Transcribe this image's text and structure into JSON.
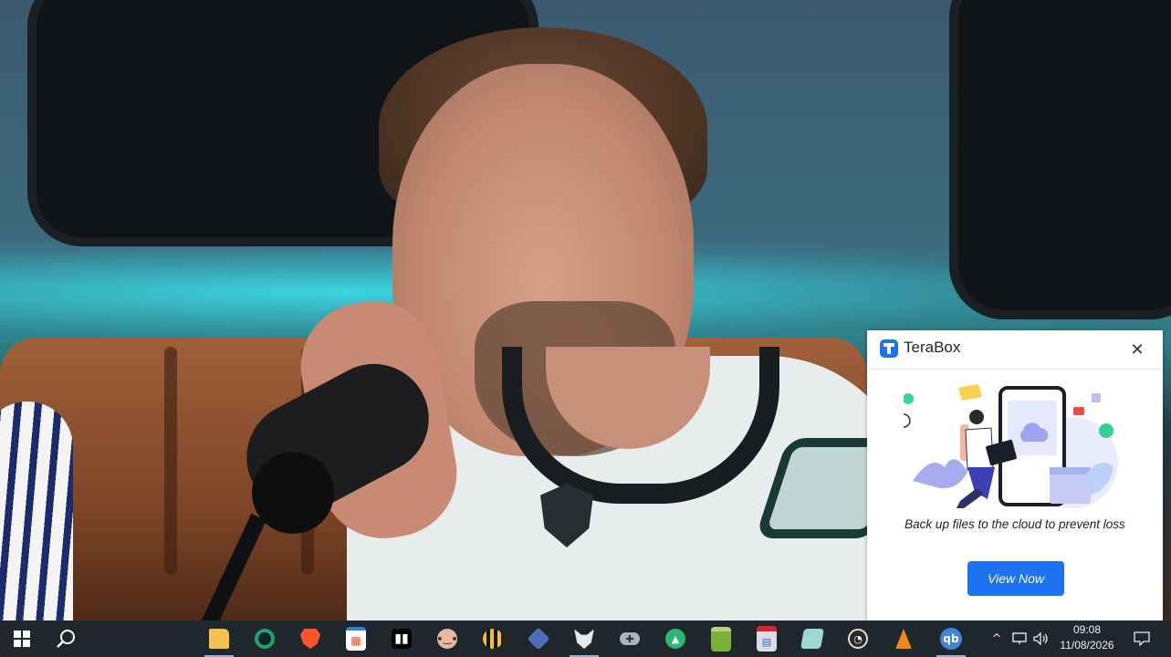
{
  "popup": {
    "brand": "TeraBox",
    "message": "Back up files to the cloud to prevent loss",
    "cta_label": "View Now",
    "close_symbol": "✕",
    "accent_color": "#1d72f2"
  },
  "taskbar": {
    "background": "#20272c",
    "apps": [
      {
        "name": "start-button",
        "icon": "windows-logo-icon"
      },
      {
        "name": "search-button",
        "icon": "search-icon"
      },
      {
        "name": "file-explorer",
        "icon": "folder-icon"
      },
      {
        "name": "green-ring-app",
        "icon": "ring-icon"
      },
      {
        "name": "brave-browser",
        "icon": "lion-icon"
      },
      {
        "name": "microsoft-store",
        "icon": "store-icon"
      },
      {
        "name": "audio-app",
        "icon": "equalizer-icon"
      },
      {
        "name": "face-app",
        "icon": "face-icon"
      },
      {
        "name": "bee-app",
        "icon": "bee-icon"
      },
      {
        "name": "cube-app",
        "icon": "cube-icon"
      },
      {
        "name": "fox-app",
        "icon": "fox-icon"
      },
      {
        "name": "game-controller",
        "icon": "gamepad-icon"
      },
      {
        "name": "green-tree-app",
        "icon": "tree-icon"
      },
      {
        "name": "archive-app",
        "icon": "archive-icon"
      },
      {
        "name": "gift-app",
        "icon": "gift-icon"
      },
      {
        "name": "notes-app",
        "icon": "note-icon"
      },
      {
        "name": "obs-studio",
        "icon": "obs-icon"
      },
      {
        "name": "vlc-player",
        "icon": "cone-icon"
      },
      {
        "name": "qbittorrent",
        "icon": "qb-icon",
        "label": "qb"
      }
    ],
    "tray": {
      "chevron": "^",
      "network_icon": "network-icon",
      "volume_icon": "volume-icon",
      "time": "09:08",
      "date": "11/08/2026",
      "notification_icon": "notification-icon"
    }
  }
}
